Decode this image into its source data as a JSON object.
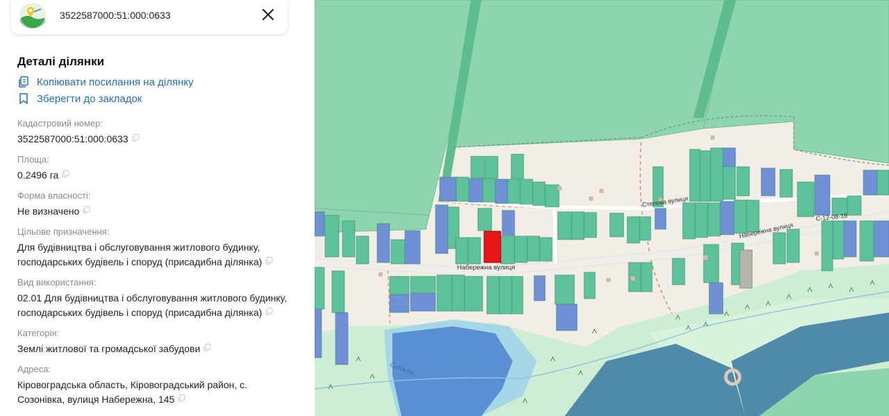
{
  "search": {
    "query": "3522587000:51:000:0633"
  },
  "details": {
    "title": "Деталі ділянки",
    "actions": {
      "copy_link": "Копіювати посилання на ділянку",
      "bookmark": "Зберегти до закладок"
    },
    "fields": [
      {
        "label": "Кадастровий номер:",
        "value": "3522587000:51:000:0633"
      },
      {
        "label": "Площа:",
        "value": "0.2496 га"
      },
      {
        "label": "Форма власності:",
        "value": "Не визначено"
      },
      {
        "label": "Цільове призначення:",
        "value_lines": [
          "Для будівництва і обслуговування житлового будинку,",
          "господарських будівель і споруд (присадибна ділянка)"
        ]
      },
      {
        "label": "Вид використання:",
        "value_lines": [
          "02.01 Для будівництва і обслуговування житлового будинку,",
          "господарських будівель і споруд (присадибна ділянка)"
        ]
      },
      {
        "label": "Категорія:",
        "value": "Землі житлової та громадської забудови"
      },
      {
        "label": "Адреса:",
        "value_lines": [
          "Кіровоградська область, Кіровоградський район, с.",
          "Созонівка, вулиця Набережна, 145"
        ]
      }
    ]
  },
  "map": {
    "street_labels": {
      "naberezhna_main": "Набережна вулиця",
      "naberezhna_east": "Набережна вулиця",
      "stepova": "Степова вулиця",
      "road_code": "С-12-08-18",
      "river": "Сугоклія"
    },
    "colors": {
      "selected_parcel": "#e8151b",
      "parcel_green": "#5ec29a",
      "parcel_blue": "#6f8fd6",
      "field_green": "#8ed4ad",
      "water": "#5b8fd4",
      "road": "#ffffff"
    }
  }
}
